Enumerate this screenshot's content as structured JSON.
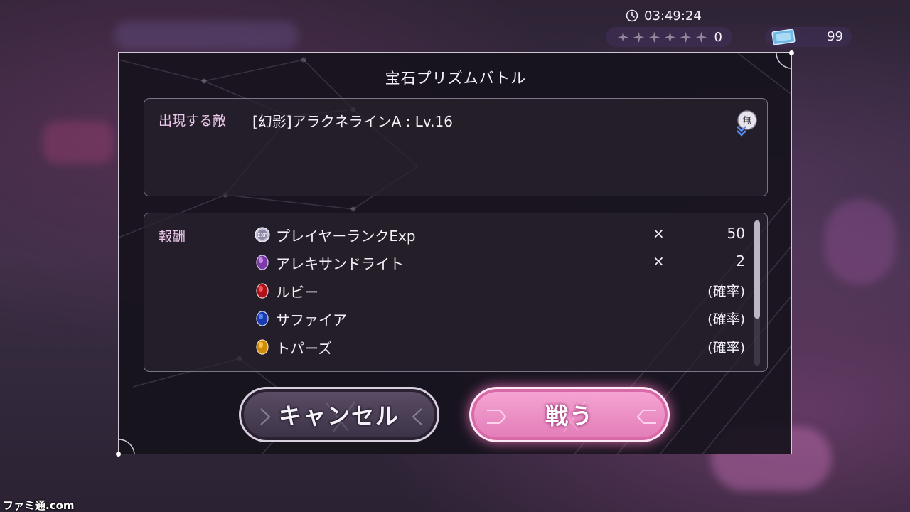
{
  "hud": {
    "timer": "03:49:24",
    "stars_count": "0",
    "ticket_count": "99"
  },
  "dialog": {
    "title": "宝石プリズムバトル",
    "enemy": {
      "label": "出現する敵",
      "name": "[幻影]アラクネラインA : Lv.16",
      "attribute_badge": "無"
    },
    "rewards": {
      "label": "報酬",
      "items": [
        {
          "name": "プレイヤーランクExp",
          "icon": "exp-icon",
          "times": "×",
          "qty": "50"
        },
        {
          "name": "アレキサンドライト",
          "icon": "alexandrite-gem-icon",
          "times": "×",
          "qty": "2"
        },
        {
          "name": "ルビー",
          "icon": "ruby-gem-icon",
          "chance": "(確率)"
        },
        {
          "name": "サファイア",
          "icon": "sapphire-gem-icon",
          "chance": "(確率)"
        },
        {
          "name": "トパーズ",
          "icon": "topaz-gem-icon",
          "chance": "(確率)"
        }
      ]
    },
    "buttons": {
      "cancel": "キャンセル",
      "fight": "戦う"
    }
  },
  "watermark": "ファミ通.com",
  "colors": {
    "accent_pink": "#e27bb8",
    "label_pink": "#ecc8ea",
    "dialog_bg": "#16121c"
  }
}
